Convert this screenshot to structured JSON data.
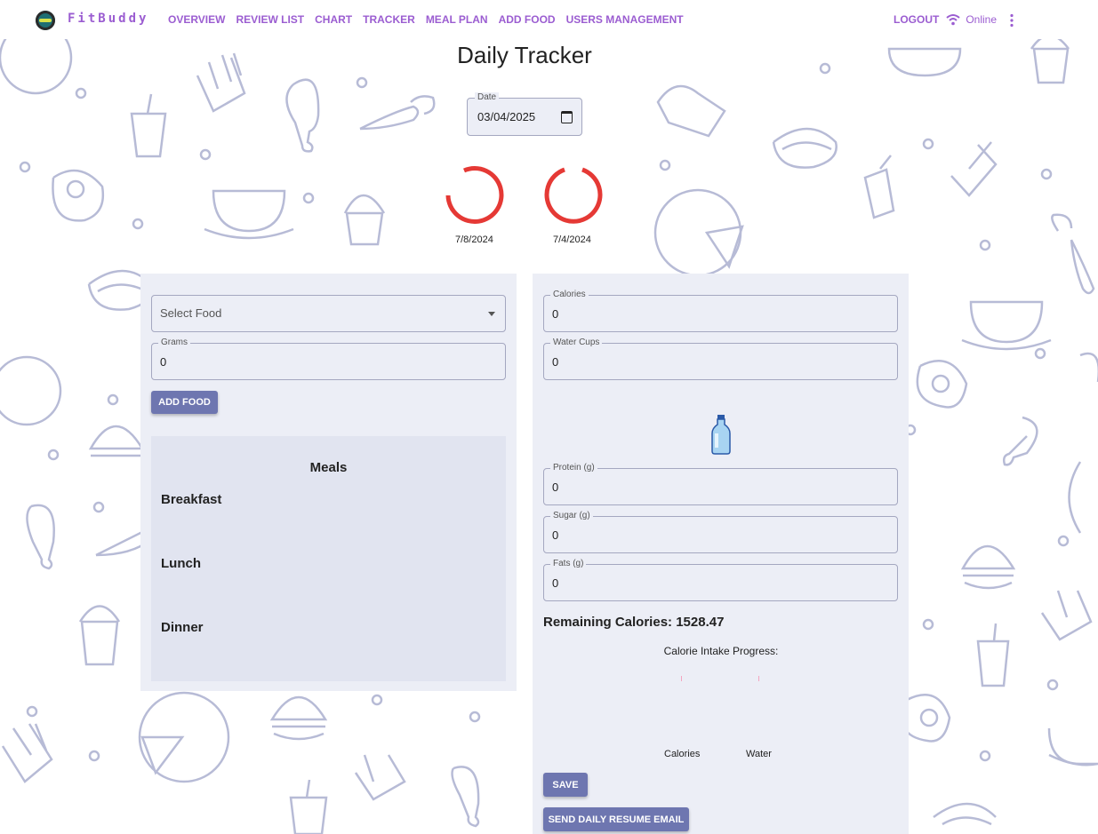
{
  "brand": "FitBuddy",
  "nav": {
    "items": [
      "OVERVIEW",
      "REVIEW LIST",
      "CHART",
      "TRACKER",
      "MEAL PLAN",
      "ADD FOOD",
      "USERS MANAGEMENT"
    ],
    "logout": "LOGOUT",
    "status": "Online"
  },
  "page": {
    "title": "Daily Tracker",
    "date_label": "Date",
    "date_value": "03/04/2025"
  },
  "rings": [
    {
      "label": "7/8/2024",
      "color": "#e53935"
    },
    {
      "label": "7/4/2024",
      "color": "#e53935"
    }
  ],
  "left_panel": {
    "select_placeholder": "Select Food",
    "grams_label": "Grams",
    "grams_value": "0",
    "add_food_button": "ADD FOOD",
    "meals_title": "Meals",
    "meals": [
      "Breakfast",
      "Lunch",
      "Dinner"
    ]
  },
  "right_panel": {
    "calories_label": "Calories",
    "calories_value": "0",
    "water_label": "Water Cups",
    "water_value": "0",
    "water_icon": "water-bottle-icon",
    "protein_label": "Protein (g)",
    "protein_value": "0",
    "sugar_label": "Sugar (g)",
    "sugar_value": "0",
    "fats_label": "Fats (g)",
    "fats_value": "0",
    "remaining": "Remaining Calories: 1528.47",
    "progress_title": "Calorie Intake Progress:",
    "progress_labels": [
      "Calories",
      "Water"
    ],
    "save_button": "SAVE",
    "email_button": "SEND DAILY RESUME EMAIL"
  },
  "colors": {
    "accent": "#9b5dd1",
    "button": "#6e76b0",
    "panel": "#eceef6",
    "ring": "#e53935"
  }
}
